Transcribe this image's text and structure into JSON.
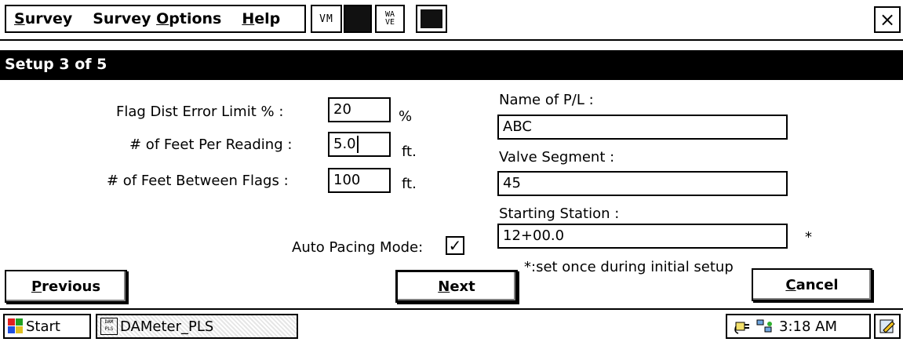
{
  "menu": {
    "survey": {
      "pre": "",
      "mn": "S",
      "post": "urvey"
    },
    "options": {
      "pre": "Survey ",
      "mn": "O",
      "post": "ptions"
    },
    "help": {
      "pre": "",
      "mn": "H",
      "post": "elp"
    },
    "vm_label": "VM",
    "wa_line1": "WA",
    "wa_line2": "VE",
    "close": "×"
  },
  "title": "Setup 3 of 5",
  "form": {
    "flag_dist_label": "Flag Dist Error Limit % :",
    "flag_dist_value": "20",
    "flag_dist_unit": "%",
    "feet_per_reading_label": "# of Feet Per Reading :",
    "feet_per_reading_value": "5.0",
    "feet_per_reading_unit": "ft.",
    "feet_between_flags_label": "# of Feet Between Flags :",
    "feet_between_flags_value": "100",
    "feet_between_flags_unit": "ft.",
    "pl_name_label": "Name of P/L :",
    "pl_name_value": "ABC",
    "valve_segment_label": "Valve Segment :",
    "valve_segment_value": "45",
    "starting_station_label": "Starting Station :",
    "starting_station_value": "12+00.0",
    "starting_station_marker": "*",
    "auto_pacing_label": "Auto Pacing Mode:",
    "auto_pacing_checked": "✓",
    "note": "*:set once during initial setup"
  },
  "buttons": {
    "previous": {
      "pre": "",
      "mn": "P",
      "post": "revious"
    },
    "next": {
      "pre": "",
      "mn": "N",
      "post": "ext"
    },
    "cancel": {
      "pre": "",
      "mn": "C",
      "post": "ancel"
    }
  },
  "taskbar": {
    "start": "Start",
    "app_icon_text": "DAM PLS",
    "app": "DAMeter_PLS",
    "time": "3:18 AM"
  },
  "colors": {
    "titlebar": "#000000",
    "background": "#ffffff"
  }
}
